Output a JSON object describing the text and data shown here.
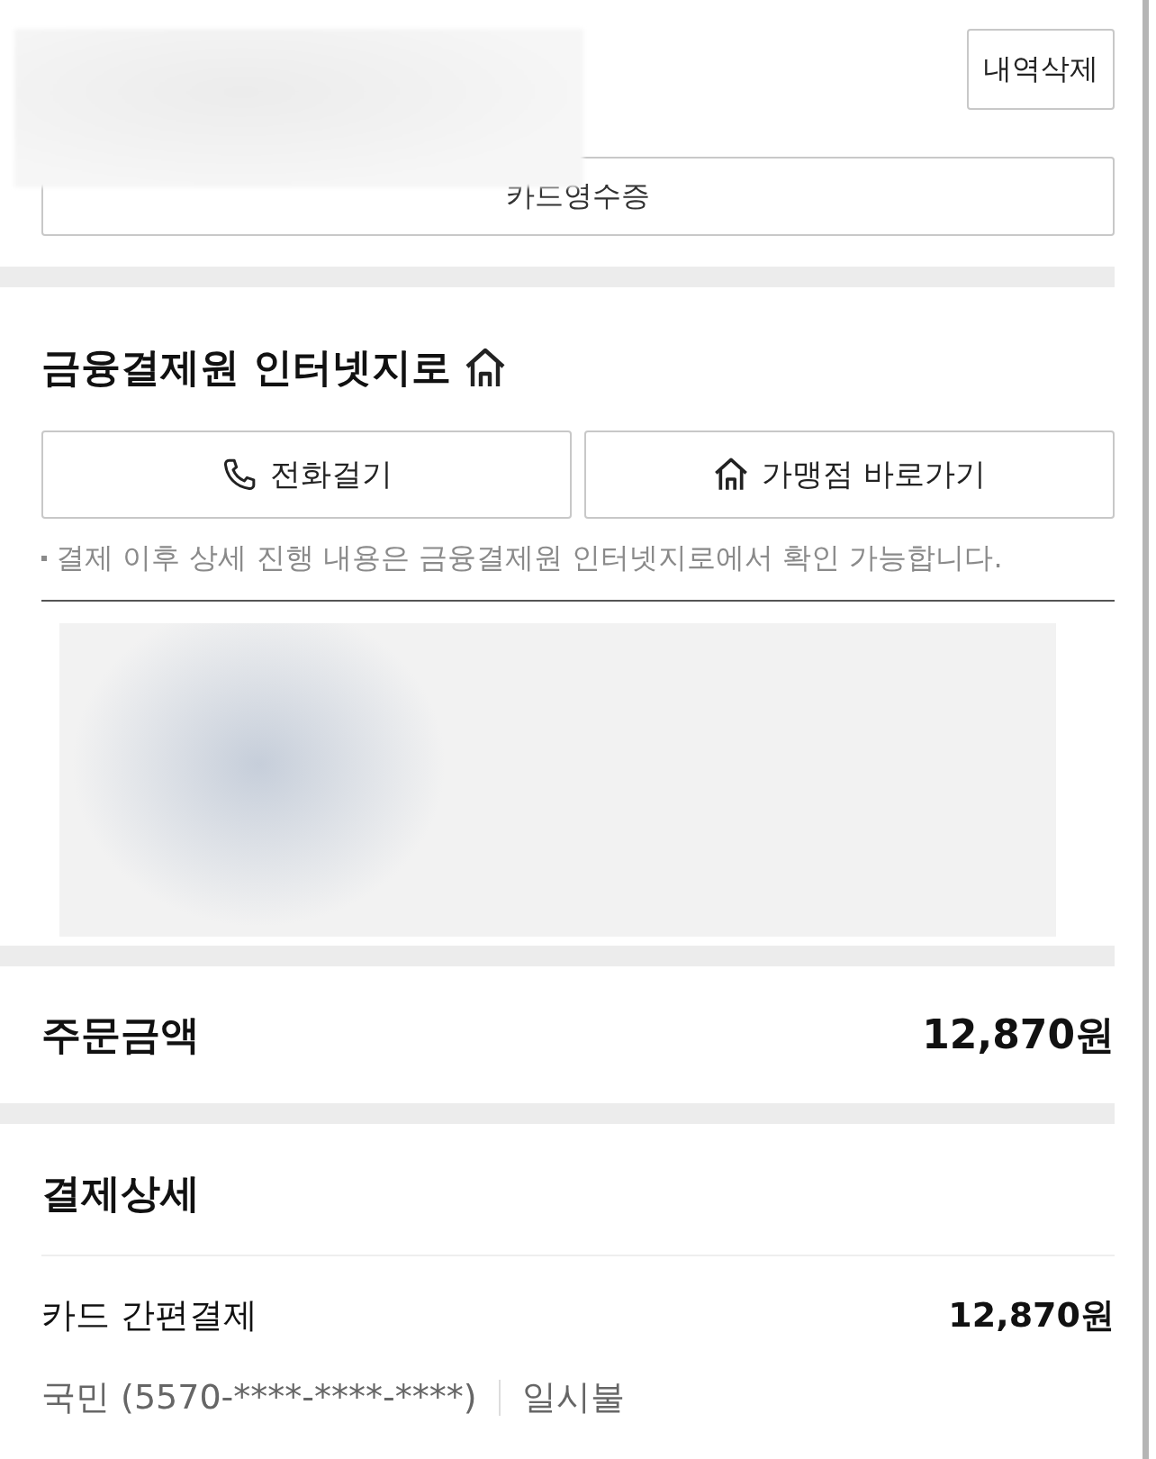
{
  "header": {
    "delete_button": "내역삭제",
    "receipt_button": "카드영수증"
  },
  "merchant": {
    "name": "금융결제원 인터넷지로",
    "buttons": [
      {
        "kind": "phone",
        "label": "전화걸기"
      },
      {
        "kind": "home",
        "label": "가맹점 바로가기"
      }
    ],
    "note": "결제 이후 상세 진행 내용은 금융결제원 인터넷지로에서 확인 가능합니다."
  },
  "order": {
    "label": "주문금액",
    "amount": "12,870원"
  },
  "payment": {
    "title": "결제상세",
    "method": "카드 간편결제",
    "amount": "12,870원",
    "card": "국민 (5570-****-****-****)",
    "installment": "일시불"
  }
}
